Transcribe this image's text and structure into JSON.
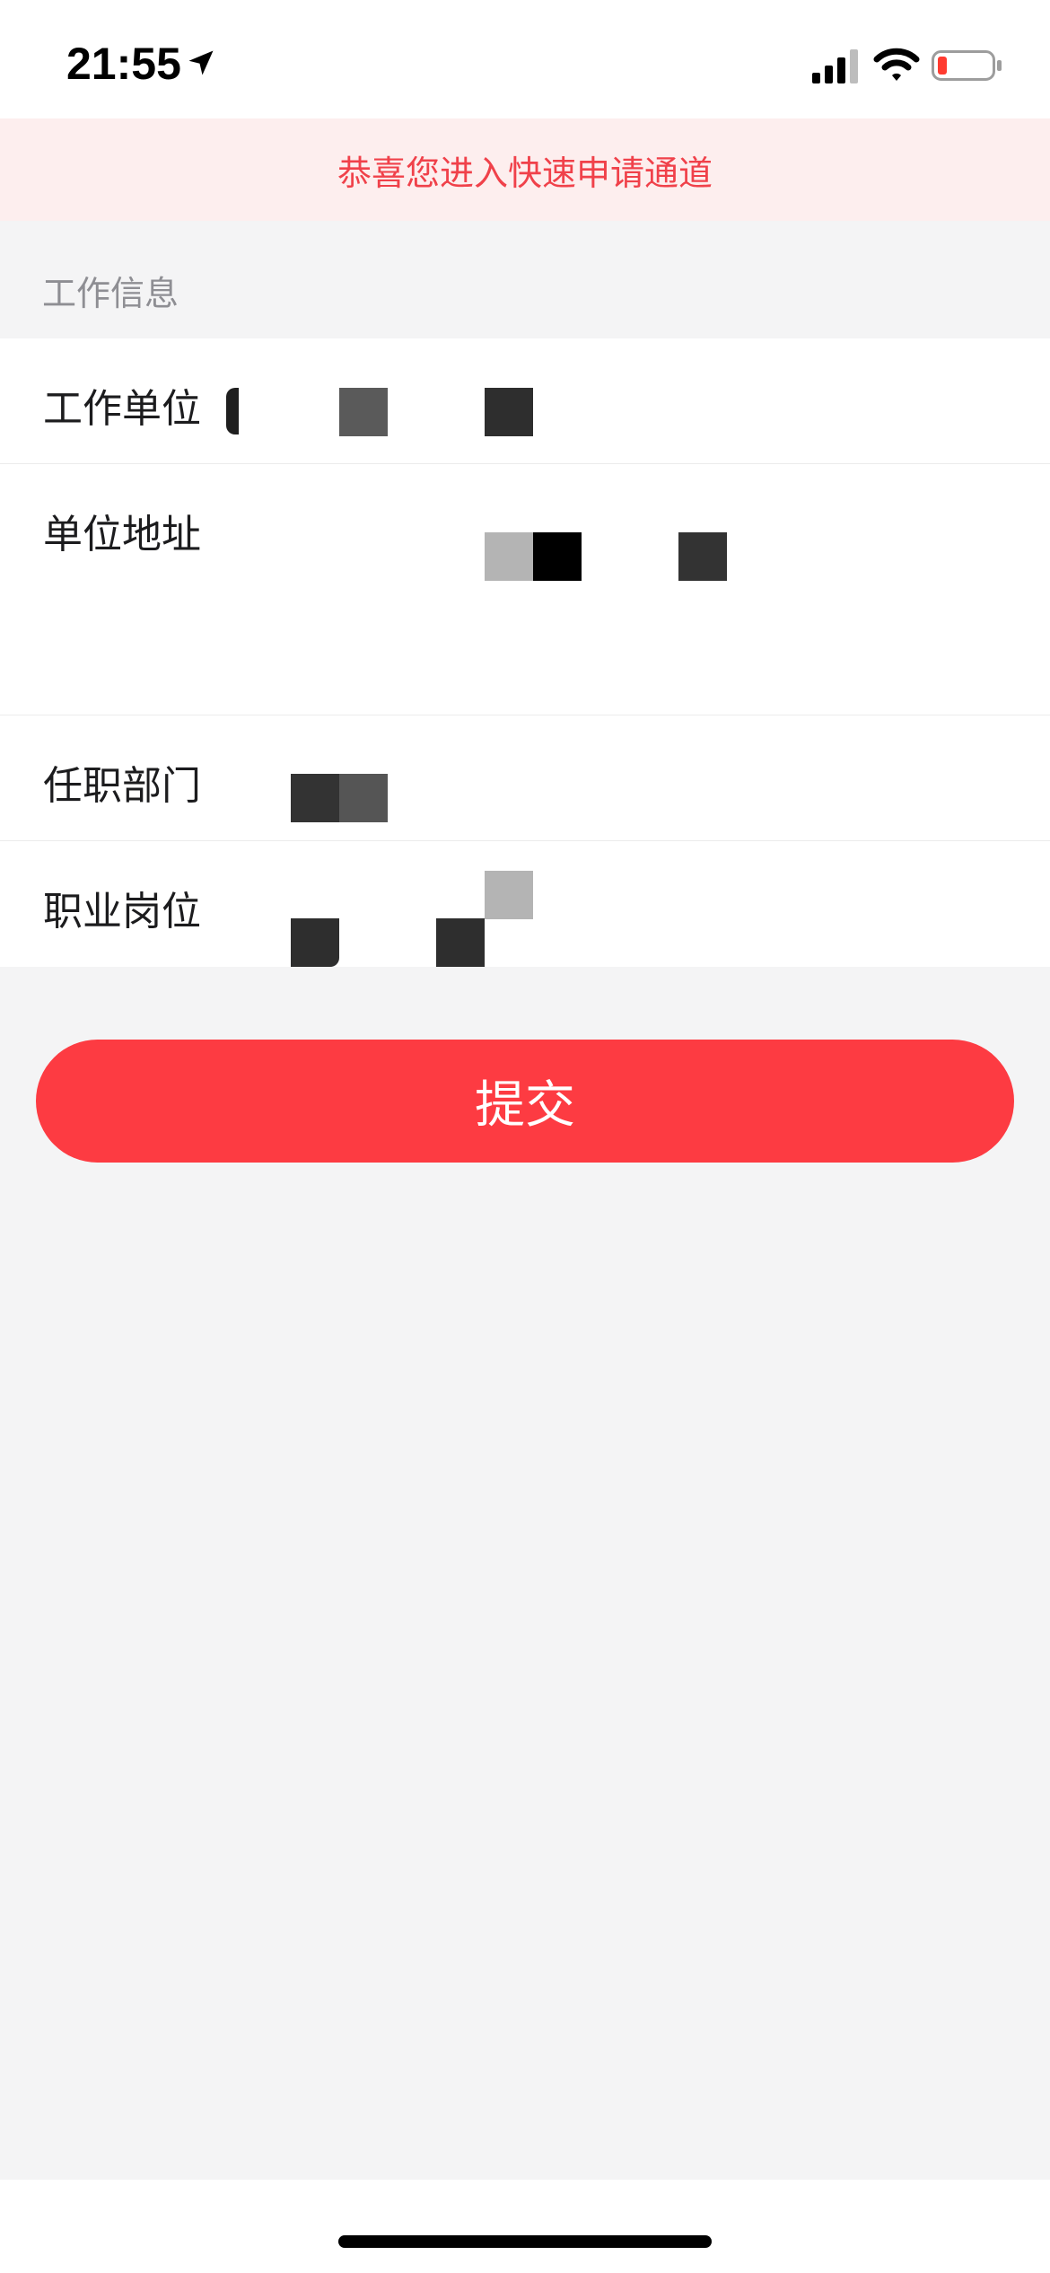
{
  "status_bar": {
    "time": "21:55",
    "icons": [
      "location-arrow-icon",
      "cellular-signal-icon",
      "wifi-icon",
      "battery-low-icon"
    ],
    "battery_color": "#ff3b30"
  },
  "banner": {
    "text": "恭喜您进入快速申请通道",
    "text_color": "#f0414a",
    "background": "#fdeeee"
  },
  "section": {
    "title": "工作信息"
  },
  "form": {
    "rows": [
      {
        "label": "工作单位",
        "value": ""
      },
      {
        "label": "单位地址",
        "value": ""
      },
      {
        "label": "任职部门",
        "value": ""
      },
      {
        "label": "职业岗位",
        "value": ""
      }
    ]
  },
  "submit": {
    "label": "提交",
    "color": "#fd3b42"
  }
}
